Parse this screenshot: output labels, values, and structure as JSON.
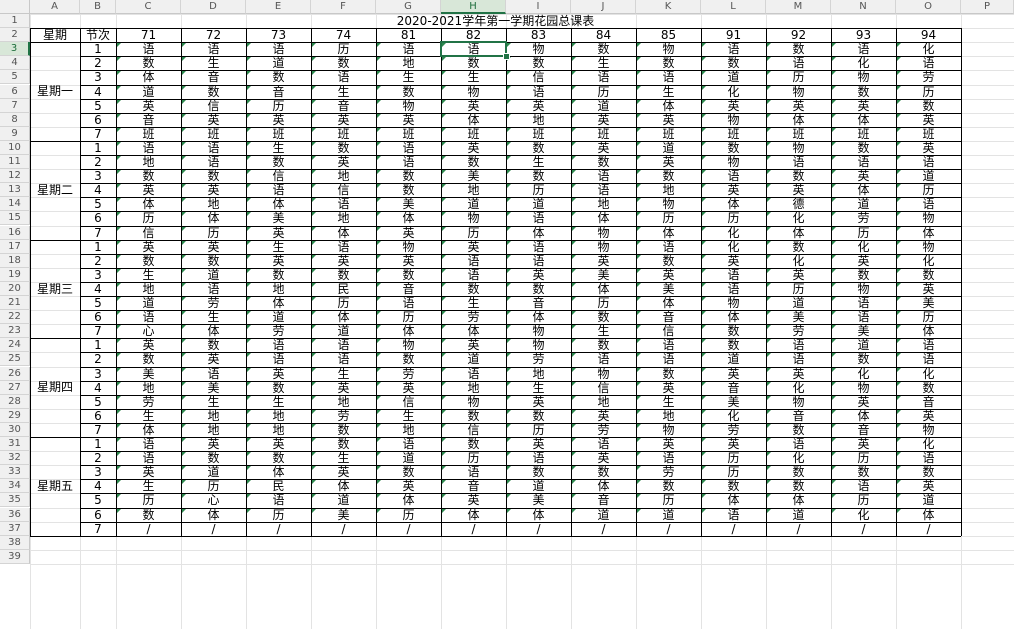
{
  "column_headers": [
    "A",
    "B",
    "C",
    "D",
    "E",
    "F",
    "G",
    "H",
    "I",
    "J",
    "K",
    "L",
    "M",
    "N",
    "O",
    "P"
  ],
  "row_headers": [
    "1",
    "2",
    "3",
    "4",
    "5",
    "6",
    "7",
    "8",
    "9",
    "10",
    "11",
    "12",
    "13",
    "14",
    "15",
    "16",
    "17",
    "18",
    "19",
    "20",
    "21",
    "22",
    "23",
    "24",
    "25",
    "26",
    "27",
    "28",
    "29",
    "30",
    "31",
    "32",
    "33",
    "34",
    "35",
    "36",
    "37",
    "38",
    "39"
  ],
  "selected_column": "H",
  "selected_row": "3",
  "accent_color": "#217346",
  "title": "2020-2021学年第一学期花园总课表",
  "header": {
    "weekday_label": "星期",
    "period_label": "节次",
    "classes": [
      "71",
      "72",
      "73",
      "74",
      "81",
      "82",
      "83",
      "84",
      "85",
      "91",
      "92",
      "93",
      "94"
    ]
  },
  "days": [
    {
      "name": "星期一",
      "rows": [
        {
          "period": "1",
          "subjects": [
            "语",
            "语",
            "语",
            "历",
            "语",
            "语",
            "物",
            "数",
            "物",
            "语",
            "数",
            "语",
            "化"
          ]
        },
        {
          "period": "2",
          "subjects": [
            "数",
            "生",
            "道",
            "数",
            "地",
            "数",
            "数",
            "生",
            "数",
            "数",
            "语",
            "化",
            "语"
          ]
        },
        {
          "period": "3",
          "subjects": [
            "体",
            "音",
            "数",
            "语",
            "生",
            "生",
            "信",
            "语",
            "语",
            "道",
            "历",
            "物",
            "劳"
          ]
        },
        {
          "period": "4",
          "subjects": [
            "道",
            "数",
            "音",
            "生",
            "数",
            "物",
            "语",
            "历",
            "生",
            "化",
            "物",
            "数",
            "历"
          ]
        },
        {
          "period": "5",
          "subjects": [
            "英",
            "信",
            "历",
            "音",
            "物",
            "英",
            "英",
            "道",
            "体",
            "英",
            "英",
            "英",
            "数"
          ]
        },
        {
          "period": "6",
          "subjects": [
            "音",
            "英",
            "英",
            "英",
            "英",
            "体",
            "地",
            "英",
            "英",
            "物",
            "体",
            "体",
            "英"
          ]
        },
        {
          "period": "7",
          "subjects": [
            "班",
            "班",
            "班",
            "班",
            "班",
            "班",
            "班",
            "班",
            "班",
            "班",
            "班",
            "班",
            "班"
          ]
        }
      ]
    },
    {
      "name": "星期二",
      "rows": [
        {
          "period": "1",
          "subjects": [
            "语",
            "语",
            "生",
            "数",
            "语",
            "英",
            "数",
            "英",
            "道",
            "数",
            "物",
            "数",
            "英"
          ]
        },
        {
          "period": "2",
          "subjects": [
            "地",
            "语",
            "数",
            "英",
            "语",
            "数",
            "生",
            "数",
            "英",
            "物",
            "语",
            "语",
            "语"
          ]
        },
        {
          "period": "3",
          "subjects": [
            "数",
            "数",
            "信",
            "地",
            "数",
            "美",
            "数",
            "语",
            "数",
            "语",
            "数",
            "英",
            "道"
          ]
        },
        {
          "period": "4",
          "subjects": [
            "英",
            "英",
            "语",
            "信",
            "数",
            "地",
            "历",
            "语",
            "地",
            "英",
            "英",
            "体",
            "历"
          ]
        },
        {
          "period": "5",
          "subjects": [
            "体",
            "地",
            "体",
            "语",
            "美",
            "道",
            "道",
            "地",
            "物",
            "体",
            "德",
            "道",
            "语"
          ]
        },
        {
          "period": "6",
          "subjects": [
            "历",
            "体",
            "美",
            "地",
            "体",
            "物",
            "语",
            "体",
            "历",
            "历",
            "化",
            "劳",
            "物"
          ]
        },
        {
          "period": "7",
          "subjects": [
            "信",
            "历",
            "英",
            "体",
            "英",
            "历",
            "体",
            "物",
            "体",
            "化",
            "体",
            "历",
            "体"
          ]
        }
      ]
    },
    {
      "name": "星期三",
      "rows": [
        {
          "period": "1",
          "subjects": [
            "英",
            "英",
            "生",
            "语",
            "物",
            "英",
            "语",
            "物",
            "语",
            "化",
            "数",
            "化",
            "物"
          ]
        },
        {
          "period": "2",
          "subjects": [
            "数",
            "数",
            "英",
            "英",
            "英",
            "语",
            "语",
            "英",
            "数",
            "英",
            "化",
            "英",
            "化"
          ]
        },
        {
          "period": "3",
          "subjects": [
            "生",
            "道",
            "数",
            "数",
            "数",
            "语",
            "英",
            "美",
            "英",
            "语",
            "英",
            "数",
            "数"
          ]
        },
        {
          "period": "4",
          "subjects": [
            "地",
            "语",
            "地",
            "民",
            "音",
            "数",
            "数",
            "体",
            "美",
            "语",
            "历",
            "物",
            "英"
          ]
        },
        {
          "period": "5",
          "subjects": [
            "道",
            "劳",
            "体",
            "历",
            "语",
            "生",
            "音",
            "历",
            "体",
            "物",
            "道",
            "语",
            "美"
          ]
        },
        {
          "period": "6",
          "subjects": [
            "语",
            "生",
            "道",
            "体",
            "历",
            "劳",
            "体",
            "数",
            "音",
            "体",
            "美",
            "语",
            "历"
          ]
        },
        {
          "period": "7",
          "subjects": [
            "心",
            "体",
            "劳",
            "道",
            "体",
            "体",
            "物",
            "生",
            "信",
            "数",
            "劳",
            "美",
            "体"
          ]
        }
      ]
    },
    {
      "name": "星期四",
      "rows": [
        {
          "period": "1",
          "subjects": [
            "英",
            "数",
            "语",
            "语",
            "物",
            "英",
            "物",
            "数",
            "语",
            "数",
            "语",
            "道",
            "语"
          ]
        },
        {
          "period": "2",
          "subjects": [
            "数",
            "英",
            "语",
            "语",
            "数",
            "道",
            "劳",
            "语",
            "语",
            "道",
            "语",
            "数",
            "语"
          ]
        },
        {
          "period": "3",
          "subjects": [
            "美",
            "语",
            "英",
            "生",
            "劳",
            "语",
            "地",
            "物",
            "数",
            "英",
            "英",
            "化",
            "化"
          ]
        },
        {
          "period": "4",
          "subjects": [
            "地",
            "美",
            "数",
            "英",
            "英",
            "地",
            "生",
            "信",
            "英",
            "音",
            "化",
            "物",
            "数"
          ]
        },
        {
          "period": "5",
          "subjects": [
            "劳",
            "生",
            "生",
            "地",
            "信",
            "物",
            "英",
            "地",
            "生",
            "美",
            "物",
            "英",
            "音"
          ]
        },
        {
          "period": "6",
          "subjects": [
            "生",
            "地",
            "地",
            "劳",
            "生",
            "数",
            "数",
            "英",
            "地",
            "化",
            "音",
            "体",
            "英"
          ]
        },
        {
          "period": "7",
          "subjects": [
            "体",
            "地",
            "地",
            "数",
            "地",
            "信",
            "历",
            "劳",
            "物",
            "劳",
            "数",
            "音",
            "物"
          ]
        }
      ]
    },
    {
      "name": "星期五",
      "rows": [
        {
          "period": "1",
          "subjects": [
            "语",
            "英",
            "英",
            "数",
            "语",
            "数",
            "英",
            "语",
            "英",
            "英",
            "语",
            "英",
            "化"
          ]
        },
        {
          "period": "2",
          "subjects": [
            "语",
            "数",
            "数",
            "生",
            "道",
            "历",
            "语",
            "英",
            "语",
            "历",
            "化",
            "历",
            "语"
          ]
        },
        {
          "period": "3",
          "subjects": [
            "英",
            "道",
            "体",
            "英",
            "数",
            "语",
            "数",
            "数",
            "劳",
            "历",
            "数",
            "数",
            "数"
          ]
        },
        {
          "period": "4",
          "subjects": [
            "生",
            "历",
            "民",
            "体",
            "英",
            "音",
            "道",
            "体",
            "数",
            "数",
            "数",
            "语",
            "英"
          ]
        },
        {
          "period": "5",
          "subjects": [
            "历",
            "心",
            "语",
            "道",
            "体",
            "英",
            "美",
            "音",
            "历",
            "体",
            "体",
            "历",
            "道"
          ]
        },
        {
          "period": "6",
          "subjects": [
            "数",
            "体",
            "历",
            "美",
            "历",
            "体",
            "体",
            "道",
            "道",
            "语",
            "道",
            "化",
            "体"
          ]
        },
        {
          "period": "7",
          "subjects": [
            "/",
            "/",
            "/",
            "/",
            "/",
            "/",
            "/",
            "/",
            "/",
            "/",
            "/",
            "/",
            "/"
          ]
        }
      ]
    }
  ]
}
